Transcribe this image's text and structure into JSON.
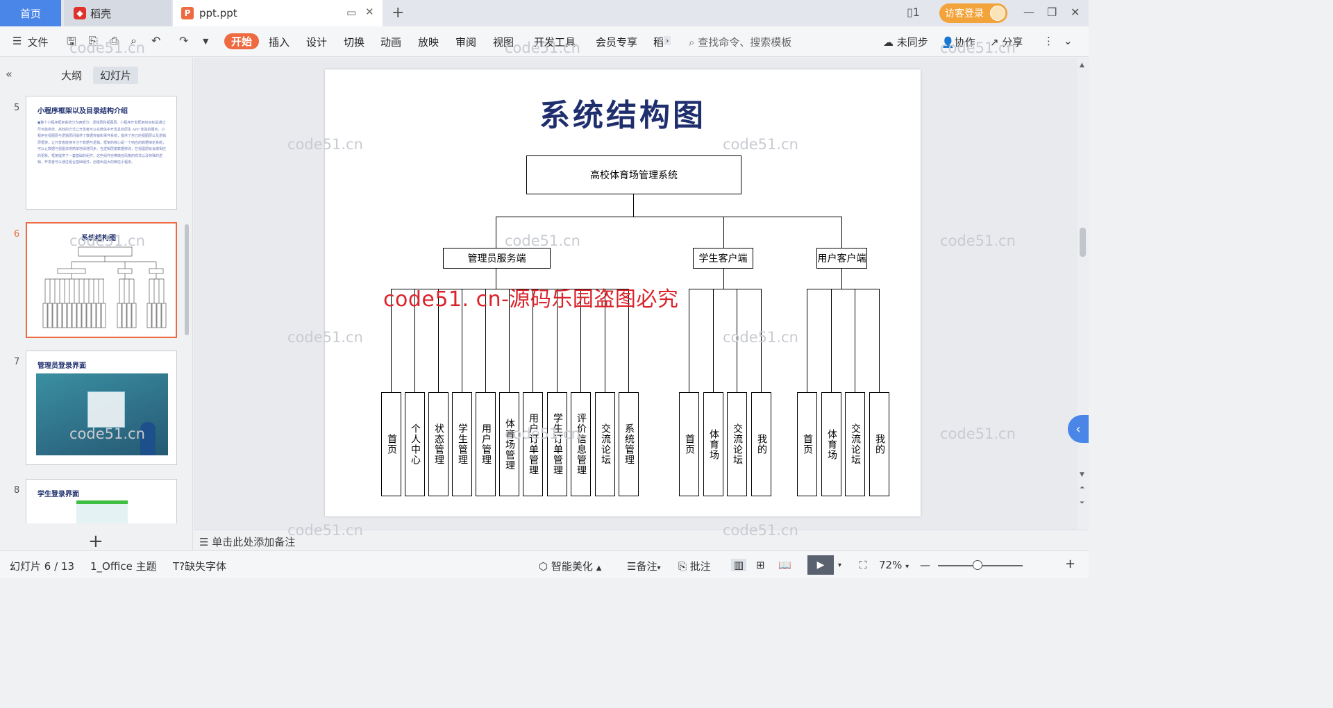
{
  "tabs": {
    "home": "首页",
    "daoke": "稻壳",
    "doc": "ppt.ppt",
    "visitor_login": "访客登录"
  },
  "toolbar": {
    "file": "文件",
    "menu_tabs": [
      "开始",
      "插入",
      "设计",
      "切换",
      "动画",
      "放映",
      "审阅",
      "视图",
      "开发工具",
      "会员专享",
      "稻"
    ],
    "search_placeholder": "查找命令、搜索模板",
    "sync": "未同步",
    "collab": "协作",
    "share": "分享"
  },
  "left_panel": {
    "tab_outline": "大纲",
    "tab_slides": "幻灯片",
    "slides": [
      {
        "num": "5",
        "title": "小程序框架以及目录结构介绍",
        "text": "●整个小程序框架系统分为两部分：逻辑层和视图层。小程序开发框架的目标是通过尽可能简单、高效的方式让开发者可以在微信中开发具有原生 APP 体验的服务。小程序在视图层与逻辑层间提供了数据传输和事件系统，提供了自己的视图层以及逻辑层框架，让开发者能够专注于数据与逻辑。框架的核心是一个响应的数据绑定系统，可以让数据与视图非常简单地保持同步。在逻辑层做数据修改，在视图层就会做相应的更新。框架提供了一套基础的组件，这些组件自带微信风格的样式以及特殊的逻辑，开发者可以通过组合基础组件，创建出强大的微信小程序。"
      },
      {
        "num": "6",
        "title": "系统结构图"
      },
      {
        "num": "7",
        "title": "管理员登录界面"
      },
      {
        "num": "8",
        "title": "学生登录界面"
      }
    ]
  },
  "slide": {
    "title": "系统结构图",
    "root": "高校体育场管理系统",
    "branches": [
      {
        "name": "管理员服务端",
        "children": [
          "首页",
          "个人中心",
          "状态管理",
          "学生管理",
          "用户管理",
          "体育场管理",
          "用户订单管理",
          "学生订单管理",
          "评价信息管理",
          "交流论坛",
          "系统管理"
        ]
      },
      {
        "name": "学生客户端",
        "children": [
          "首页",
          "体育场",
          "交流论坛",
          "我的"
        ]
      },
      {
        "name": "用户客户端",
        "children": [
          "首页",
          "体育场",
          "交流论坛",
          "我的"
        ]
      }
    ]
  },
  "watermark": {
    "big": "code51. cn-源码乐园盗图必究",
    "small": "code51.cn"
  },
  "notes_placeholder": "单击此处添加备注",
  "status": {
    "slide_counter": "幻灯片 6 / 13",
    "theme": "1_Office 主题",
    "missing_font": "缺失字体",
    "beautify": "智能美化",
    "notes": "备注",
    "comment": "批注",
    "zoom": "72%"
  }
}
